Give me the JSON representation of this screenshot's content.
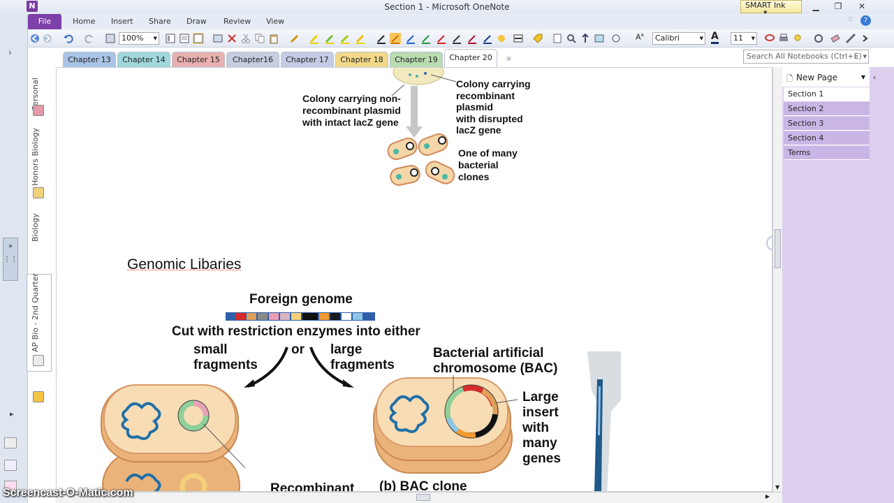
{
  "window": {
    "title": "Section 1  -  Microsoft OneNote",
    "app_letter": "N",
    "smart_ink": "SMART Ink"
  },
  "ribbon": {
    "file": "File",
    "tabs": [
      "Home",
      "Insert",
      "Share",
      "Draw",
      "Review",
      "View"
    ]
  },
  "toolbar": {
    "zoom": "100%",
    "font": "Calibri",
    "size": "11",
    "font_color_glyph": "A",
    "font_glyph": "A"
  },
  "notebooks": [
    "Personal",
    "Honors Biology",
    "Biology",
    "AP Bio - 2nd Quarter"
  ],
  "section_tabs": [
    {
      "label": "Chapter 13",
      "color": "#a9c4e6"
    },
    {
      "label": "Chapter 14",
      "color": "#9fd7dc"
    },
    {
      "label": "Chapter 15",
      "color": "#e8b0b0"
    },
    {
      "label": "Chapter16",
      "color": "#c7cde0"
    },
    {
      "label": "Chapter 17",
      "color": "#c5cbe5"
    },
    {
      "label": "Chapter 18",
      "color": "#f2d98a"
    },
    {
      "label": "Chapter 19",
      "color": "#b9dcb0"
    },
    {
      "label": "Chapter 20",
      "color": "#ffffff"
    }
  ],
  "search": {
    "placeholder": "Search All Notebooks (Ctrl+E)"
  },
  "page_pane": {
    "new_page": "New Page",
    "pages": [
      "Section 1",
      "Section 2",
      "Section 3",
      "Section 4",
      "Terms"
    ]
  },
  "note": {
    "heading": "Genomic Libaries",
    "top_labels": {
      "left": [
        "Colony carrying non-",
        "recombinant plasmid",
        "with intact lacZ gene"
      ],
      "right": [
        "Colony carrying",
        "recombinant",
        "plasmid",
        "with disrupted",
        "lacZ gene"
      ],
      "clones": [
        "One of many",
        "bacterial",
        "clones"
      ]
    },
    "diagram": {
      "foreign_genome": "Foreign genome",
      "cut": "Cut with restriction enzymes into either",
      "small": [
        "small",
        "fragments"
      ],
      "or": "or",
      "large": [
        "large",
        "fragments"
      ],
      "bac": [
        "Bacterial artificial",
        "chromosome (BAC)"
      ],
      "insert": [
        "Large",
        "insert",
        "with",
        "many",
        "genes"
      ],
      "recombinant": "Recombinant",
      "bac_clone": "(b) BAC clone"
    }
  },
  "watermark": "Screencast-O-Matic.com"
}
